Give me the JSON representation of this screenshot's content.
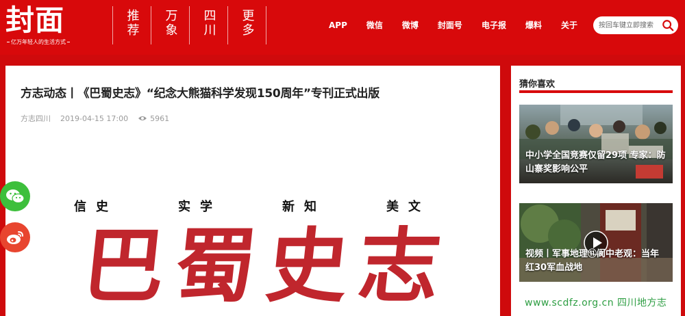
{
  "header": {
    "logo_text": "封面",
    "logo_slogan": "亿万年轻人的生活方式",
    "vertical_nav": [
      "推荐",
      "万象",
      "四川",
      "更多"
    ],
    "top_nav": [
      "APP",
      "微信",
      "微博",
      "封面号",
      "电子报",
      "爆料",
      "关于"
    ],
    "search": {
      "placeholder": "按回车键立即搜索"
    }
  },
  "article": {
    "title": "方志动态丨《巴蜀史志》“纪念大熊猫科学发现150周年”专刊正式出版",
    "source": "方志四川",
    "date": "2019-04-15 17:00",
    "views": "5961",
    "hero": {
      "top_phrases": [
        "信史",
        "实学",
        "新知",
        "美文"
      ],
      "calligraphy": [
        "巴",
        "蜀",
        "史",
        "志"
      ]
    }
  },
  "share": {
    "wechat_icon": "wechat-icon",
    "weibo_icon": "weibo-icon"
  },
  "sidebar": {
    "title": "猜你喜欢",
    "items": [
      {
        "title": "中小学全国竞赛仅留29项 专家：防山寨奖影响公平",
        "has_video": false
      },
      {
        "title": "视频丨军事地理⑪阆中老观：当年红30军血战地",
        "has_video": true
      }
    ]
  },
  "watermark": "www.scdfz.org.cn  四川地方志",
  "colors": {
    "brand_red": "#d8090b",
    "calligraphy_red": "#c0262d",
    "wechat_green": "#3dbf3c",
    "weibo_red": "#e8452f"
  }
}
